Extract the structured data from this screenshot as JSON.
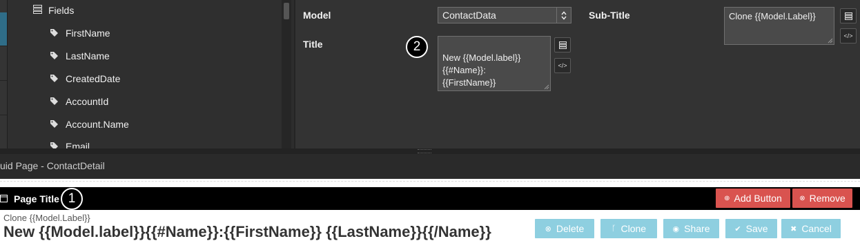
{
  "tree": {
    "root_label": "Fields",
    "items": [
      "FirstName",
      "LastName",
      "CreatedDate",
      "AccountId",
      "Account.Name",
      "Email"
    ]
  },
  "props": {
    "model_label": "Model",
    "model_value": "ContactData",
    "subtitle_label": "Sub-Title",
    "subtitle_value": "Clone {{Model.Label}}",
    "title_label": "Title",
    "title_value": "New {{Model.label}}\n{{#Name}}:\n{{FirstName}}\n{{LastName}}{{/Name}}",
    "code_btn": "</>"
  },
  "callouts": {
    "one": "1",
    "two": "2"
  },
  "page_bar": {
    "text": "uid Page - ContactDetail"
  },
  "page_title": {
    "label": "Page Title",
    "add_button": "Add Button",
    "remove_button": "Remove",
    "subtitle": "Clone {{Model.Label}}",
    "title": "New {{Model.label}}{{#Name}}:{{FirstName}} {{LastName}}{{/Name}}",
    "actions": [
      "Delete",
      "Clone",
      "Share",
      "Save",
      "Cancel"
    ]
  },
  "colors": {
    "accent": "#2f6d88",
    "danger": "#d9534f",
    "action": "#8ecfe0"
  }
}
